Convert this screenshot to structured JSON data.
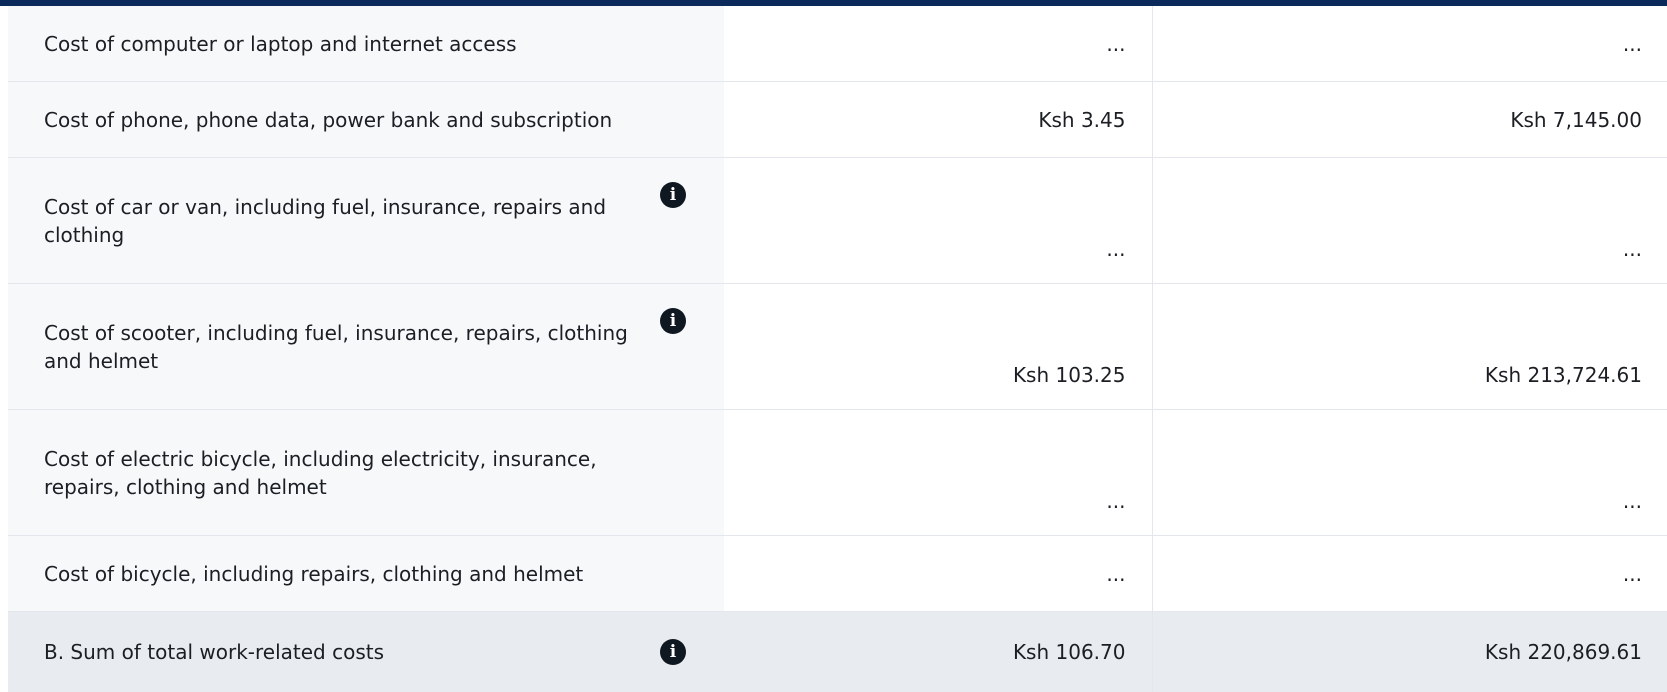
{
  "table": {
    "rows": [
      {
        "label": "Cost of computer or laptop and internet access",
        "has_info": false,
        "month": "...",
        "year": "..."
      },
      {
        "label": "Cost of phone, phone data, power bank and subscription",
        "has_info": false,
        "month": "Ksh 3.45",
        "year": "Ksh 7,145.00"
      },
      {
        "label": "Cost of car or van, including fuel, insurance, repairs and clothing",
        "has_info": true,
        "month": "...",
        "year": "..."
      },
      {
        "label": "Cost of scooter, including fuel, insurance, repairs, clothing and helmet",
        "has_info": true,
        "month": "Ksh 103.25",
        "year": "Ksh 213,724.61"
      },
      {
        "label": "Cost of electric bicycle, including electricity, insurance, repairs, clothing and helmet",
        "has_info": false,
        "month": "...",
        "year": "..."
      },
      {
        "label": "Cost of bicycle, including repairs, clothing and helmet",
        "has_info": false,
        "month": "...",
        "year": "..."
      }
    ],
    "total": {
      "label": "B. Sum of total work-related costs",
      "has_info": true,
      "month": "Ksh 106.70",
      "year": "Ksh 220,869.61"
    },
    "info_glyph": "i"
  },
  "icons": {
    "info": "info-circle-icon"
  },
  "colors": {
    "header_bar": "#0b2a5b",
    "label_bg": "#f7f8fa",
    "total_bg": "#e8ebf0",
    "icon": "#0f1720"
  }
}
